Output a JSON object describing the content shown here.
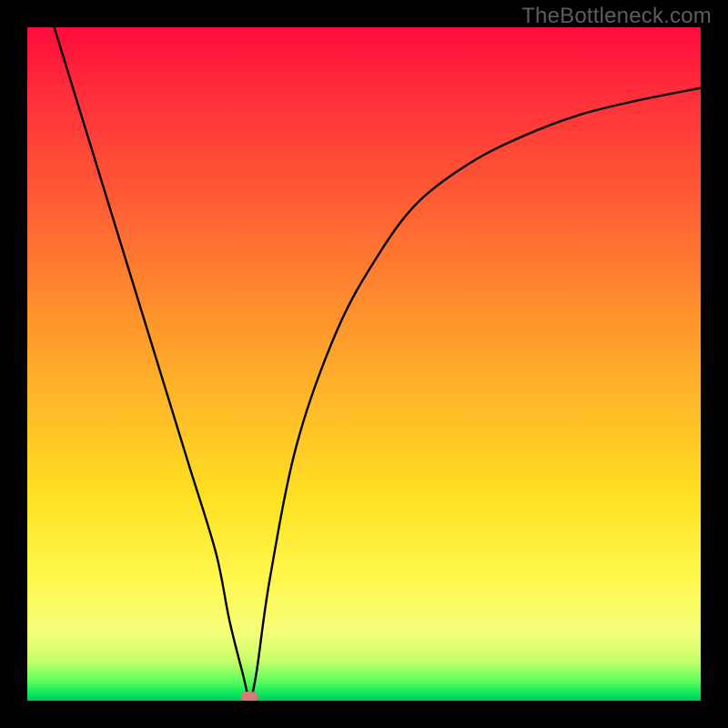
{
  "watermark": "TheBottleneck.com",
  "chart_data": {
    "type": "line",
    "title": "",
    "xlabel": "",
    "ylabel": "",
    "xlim": [
      0,
      100
    ],
    "ylim": [
      0,
      100
    ],
    "grid": false,
    "legend": false,
    "series": [
      {
        "name": "curve",
        "x": [
          4,
          8,
          12,
          16,
          20,
          24,
          28,
          30,
          32,
          33,
          34,
          36,
          40,
          46,
          52,
          58,
          66,
          74,
          82,
          90,
          100
        ],
        "y": [
          100,
          87,
          74,
          61,
          48,
          35,
          22,
          12,
          4,
          0.5,
          4,
          18,
          38,
          55,
          66,
          74,
          80,
          84,
          87,
          89,
          91
        ]
      }
    ],
    "marker": {
      "x": 33,
      "y": 0.5
    },
    "gradient_stops": [
      {
        "pct": 0,
        "color": "#ff0b3b"
      },
      {
        "pct": 25,
        "color": "#ff5a34"
      },
      {
        "pct": 55,
        "color": "#ffb728"
      },
      {
        "pct": 82,
        "color": "#fff84f"
      },
      {
        "pct": 97,
        "color": "#60ff5e"
      },
      {
        "pct": 100,
        "color": "#02c95c"
      }
    ]
  }
}
